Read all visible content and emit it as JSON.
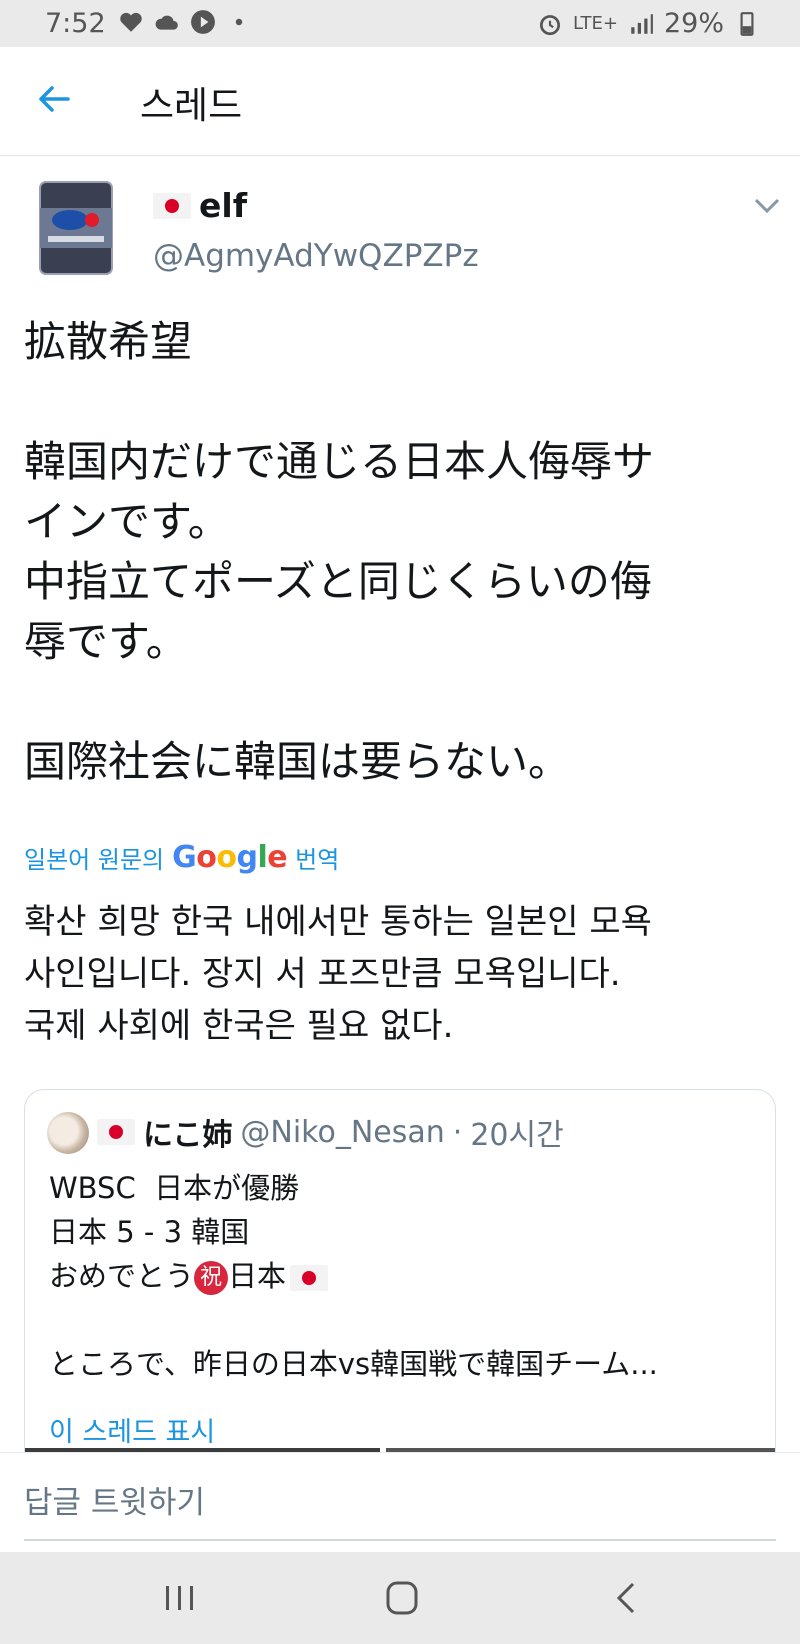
{
  "status_bar": {
    "time": "7:52",
    "battery": "29%",
    "network": "LTE+"
  },
  "header": {
    "title": "스레드"
  },
  "tweet": {
    "author_name": "elf",
    "handle": "@AgmyAdYwQZPZPz",
    "text_lines": [
      "拡散希望",
      "",
      "韓国内だけで通じる日本人侮辱サ",
      "インです。",
      "中指立てポーズと同じくらいの侮",
      "辱です。",
      "",
      "国際社会に韓国は要らない。"
    ],
    "translate_prefix": "일본어 원문의",
    "translate_brand": [
      "G",
      "o",
      "o",
      "g",
      "l",
      "e"
    ],
    "translate_suffix": "번역",
    "translation_lines": [
      "확산 희망 한국 내에서만 통하는 일본인 모욕",
      "사인입니다. 장지 서 포즈만큼 모욕입니다.",
      "국제 사회에 한국은 필요 없다."
    ]
  },
  "quote": {
    "name": "にこ姉",
    "handle": "@Niko_Nesan",
    "separator": "·",
    "time": "20시간",
    "line1": "WBSC  日本が優勝",
    "line2": "日本 5 - 3 韓国",
    "line3_a": "おめでとう",
    "badge": "祝",
    "line3_b": "日本",
    "line5": "ところで、昨日の日本vs韓国戦で韓国チーム...",
    "show_thread": "이 스레드 표시"
  },
  "reply": {
    "placeholder": "답글 트윗하기"
  },
  "colors": {
    "link": "#1b95e0",
    "secondary": "#657786",
    "flag_red": "#d80027"
  }
}
